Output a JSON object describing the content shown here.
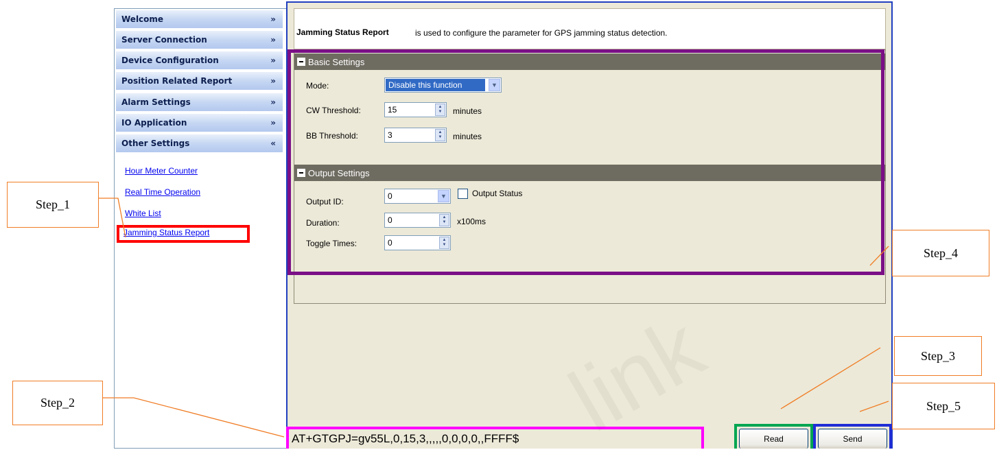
{
  "sidebar": {
    "items": [
      {
        "label": "Welcome",
        "chevron": "»"
      },
      {
        "label": "Server Connection",
        "chevron": "»"
      },
      {
        "label": "Device Configuration",
        "chevron": "»"
      },
      {
        "label": "Position Related Report",
        "chevron": "»"
      },
      {
        "label": "Alarm Settings",
        "chevron": "»"
      },
      {
        "label": "IO Application",
        "chevron": "»"
      },
      {
        "label": "Other Settings",
        "chevron": "«"
      }
    ],
    "sub_links": [
      "Hour Meter Counter",
      "Real Time Operation",
      "White List",
      "Jamming Status Report"
    ]
  },
  "main": {
    "title": "Jamming Status Report",
    "description": "is used to configure the parameter for GPS jamming status detection.",
    "basic": {
      "header": "Basic Settings",
      "mode_label": "Mode:",
      "mode_value": "Disable this function",
      "cw_label": "CW Threshold:",
      "cw_value": "15",
      "cw_unit": "minutes",
      "bb_label": "BB Threshold:",
      "bb_value": "3",
      "bb_unit": "minutes"
    },
    "output": {
      "header": "Output Settings",
      "output_id_label": "Output ID:",
      "output_id_value": "0",
      "output_status_label": "Output Status",
      "duration_label": "Duration:",
      "duration_value": "0",
      "duration_unit": "x100ms",
      "toggle_label": "Toggle Times:",
      "toggle_value": "0"
    }
  },
  "bottom": {
    "command": "AT+GTGPJ=gv55L,0,15,3,,,,,0,0,0,0,,FFFF$",
    "read_label": "Read",
    "send_label": "Send"
  },
  "annotations": {
    "step1": "Step_1",
    "step2": "Step_2",
    "step3": "Step_3",
    "step4": "Step_4",
    "step5": "Step_5"
  },
  "watermark": "link",
  "colors": {
    "step1_box": "#ff0000",
    "step2_box": "#ff00ff",
    "step3_box": "#00a651",
    "step4_box": "#7b0f86",
    "step5_box": "#1f2ed6",
    "callout_line": "#f07c24",
    "link": "#0000ee",
    "selected_mode_bg": "#316ac5"
  }
}
